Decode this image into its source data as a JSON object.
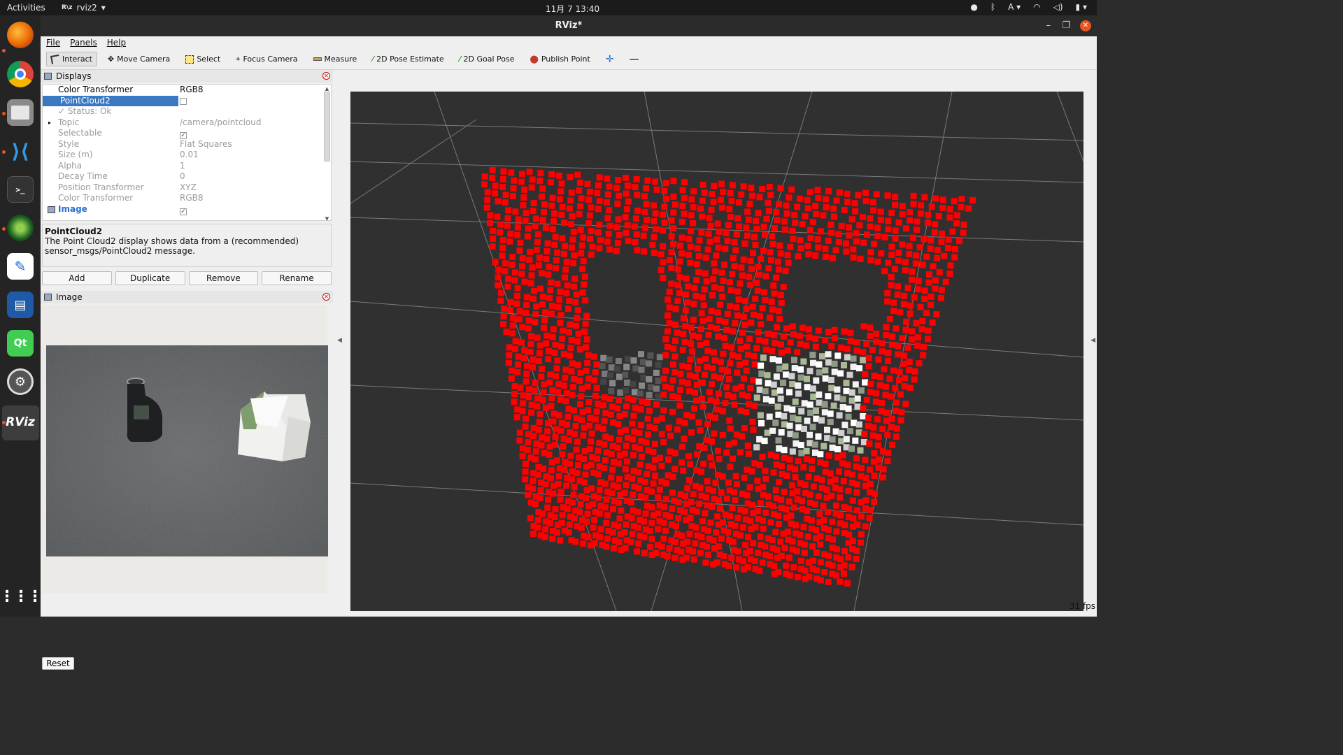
{
  "topbar": {
    "activities": "Activities",
    "app_name": "rviz2",
    "clock": "11月 7  13:40",
    "input_method": "A"
  },
  "window": {
    "title": "RViz*"
  },
  "menu": {
    "file": "File",
    "panels": "Panels",
    "help": "Help"
  },
  "toolbar": {
    "tools": [
      {
        "label": "Interact",
        "icon": "cursor-icon"
      },
      {
        "label": "Move Camera",
        "icon": "move-camera-icon"
      },
      {
        "label": "Select",
        "icon": "select-icon"
      },
      {
        "label": "Focus Camera",
        "icon": "focus-icon"
      },
      {
        "label": "Measure",
        "icon": "ruler-icon"
      },
      {
        "label": "2D Pose Estimate",
        "icon": "green-arrow-icon"
      },
      {
        "label": "2D Goal Pose",
        "icon": "green-arrow-icon"
      },
      {
        "label": "Publish Point",
        "icon": "map-pin-icon"
      }
    ]
  },
  "displays": {
    "title": "Displays",
    "rows": [
      {
        "key": "Color Transformer",
        "value": "RGB8"
      },
      {
        "key": "PointCloud2",
        "value": ""
      },
      {
        "key": "Status: Ok",
        "value": ""
      },
      {
        "key": "Topic",
        "value": "/camera/pointcloud"
      },
      {
        "key": "Selectable",
        "value": ""
      },
      {
        "key": "Style",
        "value": "Flat Squares"
      },
      {
        "key": "Size (m)",
        "value": "0.01"
      },
      {
        "key": "Alpha",
        "value": "1"
      },
      {
        "key": "Decay Time",
        "value": "0"
      },
      {
        "key": "Position Transformer",
        "value": "XYZ"
      },
      {
        "key": "Color Transformer",
        "value": "RGB8"
      },
      {
        "key": "Image",
        "value": ""
      }
    ],
    "description_title": "PointCloud2",
    "description_text": "The Point Cloud2 display shows data from a (recommended) sensor_msgs/PointCloud2 message.",
    "buttons": {
      "add": "Add",
      "duplicate": "Duplicate",
      "remove": "Remove",
      "rename": "Rename"
    }
  },
  "image_panel": {
    "title": "Image",
    "bottle_label": "",
    "box_label": ""
  },
  "footer": {
    "reset": "Reset",
    "fps": "31 fps"
  },
  "colors": {
    "selection": "#3a78c2",
    "point_red": "#ff0000",
    "view_bg": "#303030",
    "accent": "#e95420"
  }
}
